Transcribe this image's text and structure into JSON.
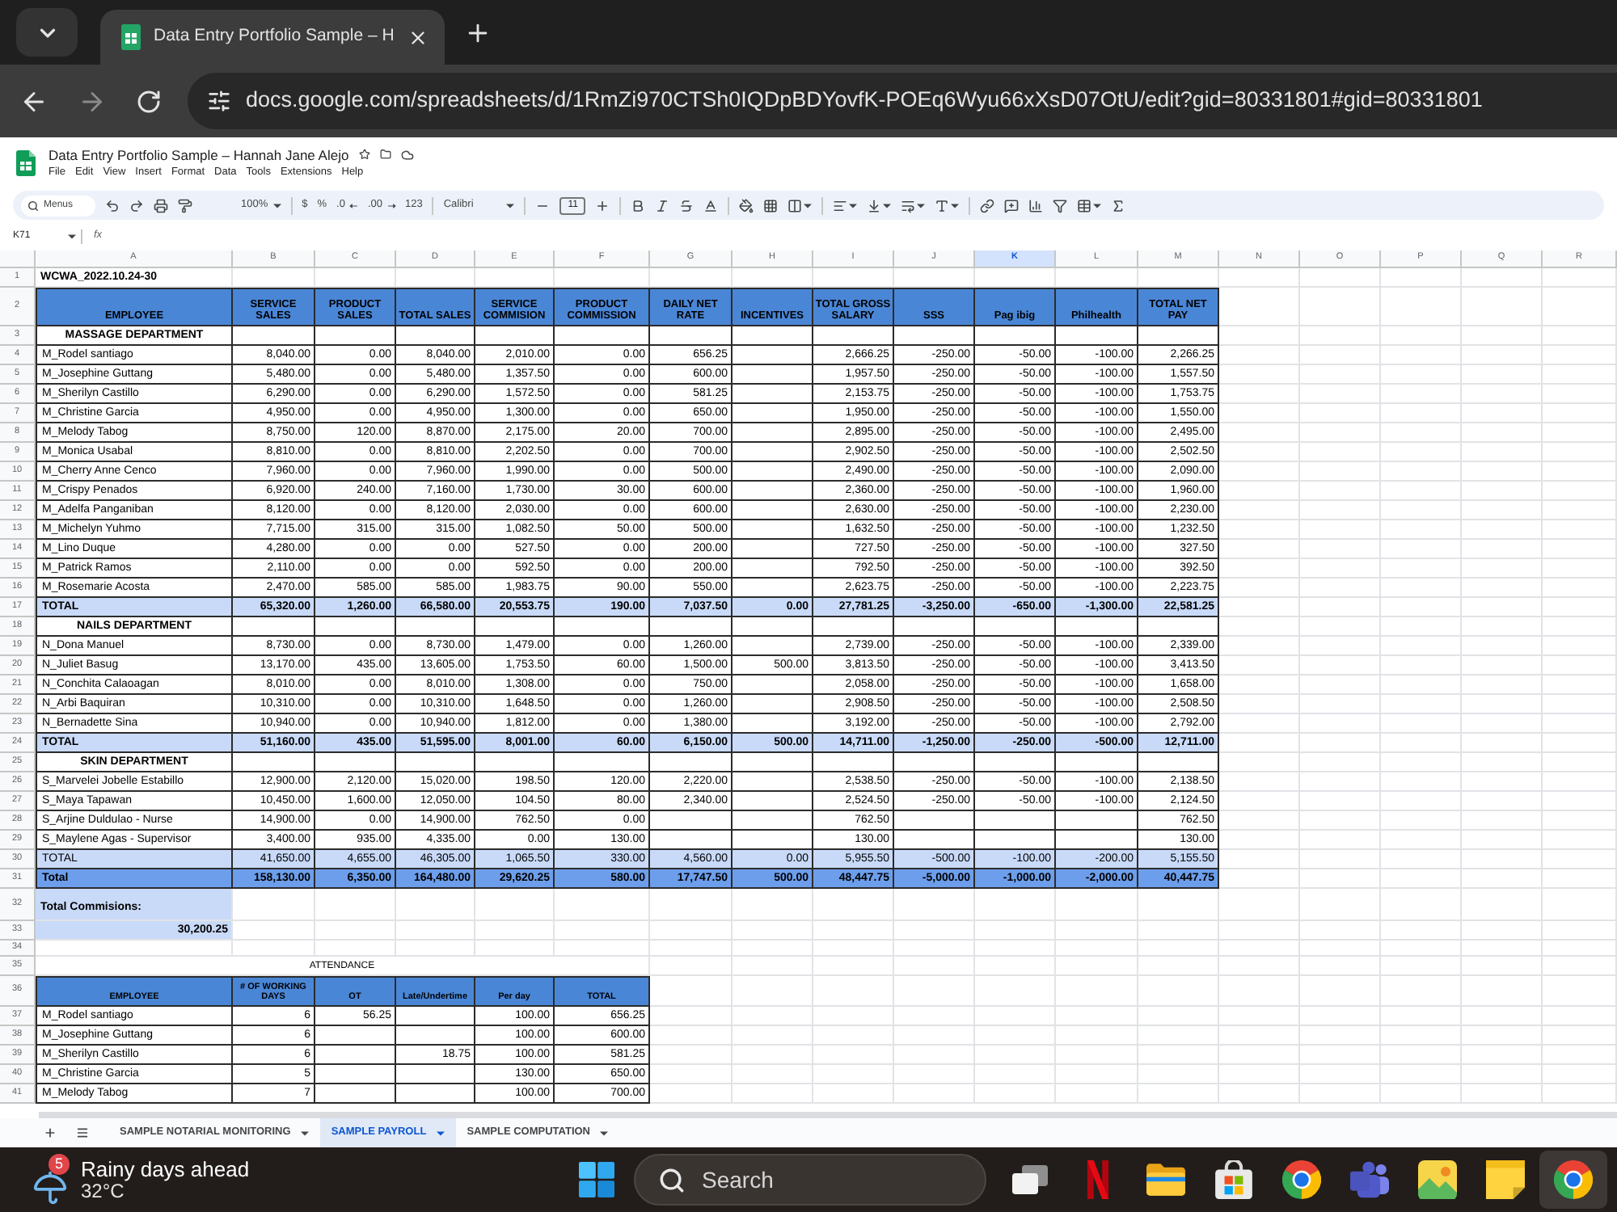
{
  "browser": {
    "tab_title": "Data Entry Portfolio Sample – H",
    "url": "docs.google.com/spreadsheets/d/1RmZi970CTSh0IQDpBDYovfK-POEq6Wyu66xXsD07OtU/edit?gid=80331801#gid=80331801"
  },
  "document": {
    "title": "Data Entry Portfolio Sample – Hannah Jane Alejo",
    "menu": [
      "File",
      "Edit",
      "View",
      "Insert",
      "Format",
      "Data",
      "Tools",
      "Extensions",
      "Help"
    ]
  },
  "toolbar": {
    "search_placeholder": "Menus",
    "zoom": "100%",
    "currency": "$",
    "percent": "%",
    "decrease_decimal": ".0",
    "increase_decimal": ".00",
    "number_formats": "123",
    "font": "Calibri",
    "font_size": "11"
  },
  "formula_bar": {
    "name_box": "K71",
    "function_label": "fx"
  },
  "sheet": {
    "columns": [
      {
        "label": "A",
        "selected": false
      },
      {
        "label": "B",
        "selected": false
      },
      {
        "label": "C",
        "selected": false
      },
      {
        "label": "D",
        "selected": false
      },
      {
        "label": "E",
        "selected": false
      },
      {
        "label": "F",
        "selected": false
      },
      {
        "label": "G",
        "selected": false
      },
      {
        "label": "H",
        "selected": false
      },
      {
        "label": "I",
        "selected": false
      },
      {
        "label": "J",
        "selected": false
      },
      {
        "label": "K",
        "selected": true
      },
      {
        "label": "L",
        "selected": false
      },
      {
        "label": "M",
        "selected": false
      },
      {
        "label": "N",
        "selected": false
      },
      {
        "label": "O",
        "selected": false
      },
      {
        "label": "P",
        "selected": false
      },
      {
        "label": "Q",
        "selected": false
      },
      {
        "label": "R",
        "selected": false
      }
    ],
    "rows": [
      {
        "number": "1",
        "kind": "title",
        "cells": [
          "WCWA_2022.10.24-30"
        ]
      },
      {
        "number": "2",
        "kind": "table_header",
        "cells": [
          "EMPLOYEE",
          "SERVICE SALES",
          "PRODUCT SALES",
          "TOTAL SALES",
          "SERVICE COMMISION",
          "PRODUCT COMMISSION",
          "DAILY NET RATE",
          "INCENTIVES",
          "TOTAL GROSS SALARY",
          "SSS",
          "Pag ibig",
          "Philhealth",
          "TOTAL NET PAY"
        ]
      },
      {
        "number": "3",
        "kind": "department",
        "cells": [
          "MASSAGE DEPARTMENT"
        ]
      },
      {
        "number": "4",
        "kind": "employee",
        "cells": [
          "M_Rodel santiago",
          "8,040.00",
          "0.00",
          "8,040.00",
          "2,010.00",
          "0.00",
          "656.25",
          null,
          "2,666.25",
          "-250.00",
          "-50.00",
          "-100.00",
          "2,266.25"
        ]
      },
      {
        "number": "5",
        "kind": "employee",
        "cells": [
          "M_Josephine Guttang",
          "5,480.00",
          "0.00",
          "5,480.00",
          "1,357.50",
          "0.00",
          "600.00",
          null,
          "1,957.50",
          "-250.00",
          "-50.00",
          "-100.00",
          "1,557.50"
        ]
      },
      {
        "number": "6",
        "kind": "employee",
        "cells": [
          "M_Sherilyn Castillo",
          "6,290.00",
          "0.00",
          "6,290.00",
          "1,572.50",
          "0.00",
          "581.25",
          null,
          "2,153.75",
          "-250.00",
          "-50.00",
          "-100.00",
          "1,753.75"
        ]
      },
      {
        "number": "7",
        "kind": "employee",
        "cells": [
          "M_Christine Garcia",
          "4,950.00",
          "0.00",
          "4,950.00",
          "1,300.00",
          "0.00",
          "650.00",
          null,
          "1,950.00",
          "-250.00",
          "-50.00",
          "-100.00",
          "1,550.00"
        ]
      },
      {
        "number": "8",
        "kind": "employee",
        "cells": [
          "M_Melody Tabog",
          "8,750.00",
          "120.00",
          "8,870.00",
          "2,175.00",
          "20.00",
          "700.00",
          null,
          "2,895.00",
          "-250.00",
          "-50.00",
          "-100.00",
          "2,495.00"
        ]
      },
      {
        "number": "9",
        "kind": "employee",
        "cells": [
          "M_Monica Usabal",
          "8,810.00",
          "0.00",
          "8,810.00",
          "2,202.50",
          "0.00",
          "700.00",
          null,
          "2,902.50",
          "-250.00",
          "-50.00",
          "-100.00",
          "2,502.50"
        ]
      },
      {
        "number": "10",
        "kind": "employee",
        "cells": [
          "M_Cherry Anne Cenco",
          "7,960.00",
          "0.00",
          "7,960.00",
          "1,990.00",
          "0.00",
          "500.00",
          null,
          "2,490.00",
          "-250.00",
          "-50.00",
          "-100.00",
          "2,090.00"
        ]
      },
      {
        "number": "11",
        "kind": "employee",
        "cells": [
          "M_Crispy Penados",
          "6,920.00",
          "240.00",
          "7,160.00",
          "1,730.00",
          "30.00",
          "600.00",
          null,
          "2,360.00",
          "-250.00",
          "-50.00",
          "-100.00",
          "1,960.00"
        ]
      },
      {
        "number": "12",
        "kind": "employee",
        "cells": [
          "M_Adelfa Panganiban",
          "8,120.00",
          "0.00",
          "8,120.00",
          "2,030.00",
          "0.00",
          "600.00",
          null,
          "2,630.00",
          "-250.00",
          "-50.00",
          "-100.00",
          "2,230.00"
        ]
      },
      {
        "number": "13",
        "kind": "employee",
        "cells": [
          "M_Michelyn Yuhmo",
          "7,715.00",
          "315.00",
          "315.00",
          "1,082.50",
          "50.00",
          "500.00",
          null,
          "1,632.50",
          "-250.00",
          "-50.00",
          "-100.00",
          "1,232.50"
        ]
      },
      {
        "number": "14",
        "kind": "employee",
        "cells": [
          "M_Lino Duque",
          "4,280.00",
          "0.00",
          "0.00",
          "527.50",
          "0.00",
          "200.00",
          null,
          "727.50",
          "-250.00",
          "-50.00",
          "-100.00",
          "327.50"
        ]
      },
      {
        "number": "15",
        "kind": "employee",
        "cells": [
          "M_Patrick Ramos",
          "2,110.00",
          "0.00",
          "0.00",
          "592.50",
          "0.00",
          "200.00",
          null,
          "792.50",
          "-250.00",
          "-50.00",
          "-100.00",
          "392.50"
        ]
      },
      {
        "number": "16",
        "kind": "employee",
        "cells": [
          "M_Rosemarie Acosta",
          "2,470.00",
          "585.00",
          "585.00",
          "1,983.75",
          "90.00",
          "550.00",
          null,
          "2,623.75",
          "-250.00",
          "-50.00",
          "-100.00",
          "2,223.75"
        ]
      },
      {
        "number": "17",
        "kind": "subtotal",
        "bold": true,
        "cells": [
          "TOTAL",
          "65,320.00",
          "1,260.00",
          "66,580.00",
          "20,553.75",
          "190.00",
          "7,037.50",
          "0.00",
          "27,781.25",
          "-3,250.00",
          "-650.00",
          "-1,300.00",
          "22,581.25"
        ]
      },
      {
        "number": "18",
        "kind": "department",
        "cells": [
          "NAILS DEPARTMENT"
        ]
      },
      {
        "number": "19",
        "kind": "employee",
        "cells": [
          "N_Dona Manuel",
          "8,730.00",
          "0.00",
          "8,730.00",
          "1,479.00",
          "0.00",
          "1,260.00",
          null,
          "2,739.00",
          "-250.00",
          "-50.00",
          "-100.00",
          "2,339.00"
        ]
      },
      {
        "number": "20",
        "kind": "employee",
        "cells": [
          "N_Juliet Basug",
          "13,170.00",
          "435.00",
          "13,605.00",
          "1,753.50",
          "60.00",
          "1,500.00",
          "500.00",
          "3,813.50",
          "-250.00",
          "-50.00",
          "-100.00",
          "3,413.50"
        ]
      },
      {
        "number": "21",
        "kind": "employee",
        "cells": [
          "N_Conchita Calaoagan",
          "8,010.00",
          "0.00",
          "8,010.00",
          "1,308.00",
          "0.00",
          "750.00",
          null,
          "2,058.00",
          "-250.00",
          "-50.00",
          "-100.00",
          "1,658.00"
        ]
      },
      {
        "number": "22",
        "kind": "employee",
        "cells": [
          "N_Arbi Baquiran",
          "10,310.00",
          "0.00",
          "10,310.00",
          "1,648.50",
          "0.00",
          "1,260.00",
          null,
          "2,908.50",
          "-250.00",
          "-50.00",
          "-100.00",
          "2,508.50"
        ]
      },
      {
        "number": "23",
        "kind": "employee",
        "cells": [
          "N_Bernadette Sina",
          "10,940.00",
          "0.00",
          "10,940.00",
          "1,812.00",
          "0.00",
          "1,380.00",
          null,
          "3,192.00",
          "-250.00",
          "-50.00",
          "-100.00",
          "2,792.00"
        ]
      },
      {
        "number": "24",
        "kind": "subtotal",
        "bold": true,
        "cells": [
          "TOTAL",
          "51,160.00",
          "435.00",
          "51,595.00",
          "8,001.00",
          "60.00",
          "6,150.00",
          "500.00",
          "14,711.00",
          "-1,250.00",
          "-250.00",
          "-500.00",
          "12,711.00"
        ]
      },
      {
        "number": "25",
        "kind": "department",
        "cells": [
          "SKIN DEPARTMENT"
        ]
      },
      {
        "number": "26",
        "kind": "employee",
        "cells": [
          "S_Marvelei Jobelle Estabillo",
          "12,900.00",
          "2,120.00",
          "15,020.00",
          "198.50",
          "120.00",
          "2,220.00",
          null,
          "2,538.50",
          "-250.00",
          "-50.00",
          "-100.00",
          "2,138.50"
        ]
      },
      {
        "number": "27",
        "kind": "employee",
        "cells": [
          "S_Maya Tapawan",
          "10,450.00",
          "1,600.00",
          "12,050.00",
          "104.50",
          "80.00",
          "2,340.00",
          null,
          "2,524.50",
          "-250.00",
          "-50.00",
          "-100.00",
          "2,124.50"
        ]
      },
      {
        "number": "28",
        "kind": "employee",
        "cells": [
          "S_Arjine Duldulao - Nurse",
          "14,900.00",
          "0.00",
          "14,900.00",
          "762.50",
          "0.00",
          null,
          null,
          "762.50",
          null,
          null,
          null,
          "762.50"
        ]
      },
      {
        "number": "29",
        "kind": "employee",
        "cells": [
          "S_Maylene Agas - Supervisor",
          "3,400.00",
          "935.00",
          "4,335.00",
          "0.00",
          "130.00",
          null,
          null,
          "130.00",
          null,
          null,
          null,
          "130.00"
        ]
      },
      {
        "number": "30",
        "kind": "subtotal",
        "bold": false,
        "cells": [
          "TOTAL",
          "41,650.00",
          "4,655.00",
          "46,305.00",
          "1,065.50",
          "330.00",
          "4,560.00",
          "0.00",
          "5,955.50",
          "-500.00",
          "-100.00",
          "-200.00",
          "5,155.50"
        ]
      },
      {
        "number": "31",
        "kind": "grand_total",
        "cells": [
          "Total",
          "158,130.00",
          "6,350.00",
          "164,480.00",
          "29,620.25",
          "580.00",
          "17,747.50",
          "500.00",
          "48,447.75",
          "-5,000.00",
          "-1,000.00",
          "-2,000.00",
          "40,447.75"
        ]
      },
      {
        "number": "32",
        "kind": "summary_label",
        "cells": [
          "Total Commisions:"
        ]
      },
      {
        "number": "33",
        "kind": "summary_value",
        "cells": [
          "30,200.25"
        ]
      },
      {
        "number": "34",
        "kind": "blank"
      },
      {
        "number": "35",
        "kind": "section_title",
        "cells": [
          "ATTENDANCE"
        ]
      },
      {
        "number": "36",
        "kind": "attendance_header",
        "cells": [
          "EMPLOYEE",
          "# OF WORKING DAYS",
          "OT",
          "Late/Undertime",
          "Per day",
          "TOTAL"
        ]
      },
      {
        "number": "37",
        "kind": "attendance_row",
        "cells": [
          "M_Rodel santiago",
          "6",
          "56.25",
          null,
          "100.00",
          "656.25"
        ]
      },
      {
        "number": "38",
        "kind": "attendance_row",
        "cells": [
          "M_Josephine Guttang",
          "6",
          null,
          null,
          "100.00",
          "600.00"
        ]
      },
      {
        "number": "39",
        "kind": "attendance_row",
        "cells": [
          "M_Sherilyn Castillo",
          "6",
          null,
          "18.75",
          "100.00",
          "581.25"
        ]
      },
      {
        "number": "40",
        "kind": "attendance_row",
        "cells": [
          "M_Christine Garcia",
          "5",
          null,
          null,
          "130.00",
          "650.00"
        ]
      },
      {
        "number": "41",
        "kind": "attendance_row",
        "cells": [
          "M_Melody Tabog",
          "7",
          null,
          null,
          "100.00",
          "700.00"
        ]
      }
    ]
  },
  "sheet_tabs": [
    {
      "label": "SAMPLE NOTARIAL MONITORING",
      "selected": false
    },
    {
      "label": "SAMPLE PAYROLL",
      "selected": true
    },
    {
      "label": "SAMPLE COMPUTATION",
      "selected": false
    }
  ],
  "taskbar": {
    "weather": {
      "badge": "5",
      "summary": "Rainy days ahead",
      "temperature": "32°C"
    },
    "search_placeholder": "Search",
    "apps": [
      {
        "kind": "taskview",
        "selected": false
      },
      {
        "kind": "video",
        "selected": false
      },
      {
        "kind": "files",
        "selected": false
      },
      {
        "kind": "store",
        "selected": false
      },
      {
        "kind": "browser",
        "selected": false
      },
      {
        "kind": "chat",
        "selected": false
      },
      {
        "kind": "pictures",
        "selected": false
      },
      {
        "kind": "notes",
        "selected": false
      },
      {
        "kind": "browser",
        "selected": true
      }
    ]
  }
}
